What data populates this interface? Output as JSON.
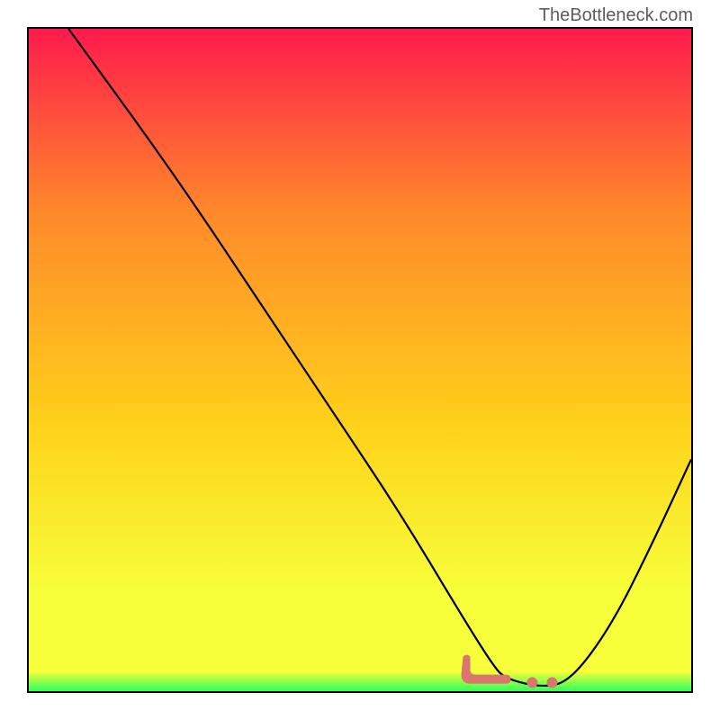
{
  "watermark": "TheBottleneck.com",
  "chart_data": {
    "type": "line",
    "title": "",
    "xlabel": "",
    "ylabel": "",
    "xlim": [
      0,
      100
    ],
    "ylim": [
      0,
      100
    ],
    "gradient_colors": {
      "top": "#ff1a4c",
      "upper_mid": "#ff8a2a",
      "mid": "#ffd21a",
      "lower_mid": "#f7ff3a",
      "bottom": "#2eff5a"
    },
    "series": [
      {
        "name": "curve",
        "color": "#000000",
        "points": [
          {
            "x": 6,
            "y": 100
          },
          {
            "x": 22,
            "y": 78
          },
          {
            "x": 36,
            "y": 57
          },
          {
            "x": 46,
            "y": 42
          },
          {
            "x": 56,
            "y": 27
          },
          {
            "x": 65,
            "y": 12
          },
          {
            "x": 70,
            "y": 4
          },
          {
            "x": 72,
            "y": 1.8
          },
          {
            "x": 78,
            "y": 0.5
          },
          {
            "x": 82,
            "y": 1.8
          },
          {
            "x": 88,
            "y": 10
          },
          {
            "x": 94,
            "y": 22
          },
          {
            "x": 100,
            "y": 35
          }
        ]
      }
    ],
    "marks": [
      {
        "name": "mark",
        "color": "#d9766e",
        "cx": 68,
        "cy": 2.5,
        "type": "rounded-L"
      },
      {
        "name": "mark",
        "color": "#d9766e",
        "cx": 76,
        "cy": 1.3,
        "type": "dot"
      },
      {
        "name": "mark",
        "color": "#d9766e",
        "cx": 79,
        "cy": 1.3,
        "type": "dot"
      }
    ]
  }
}
